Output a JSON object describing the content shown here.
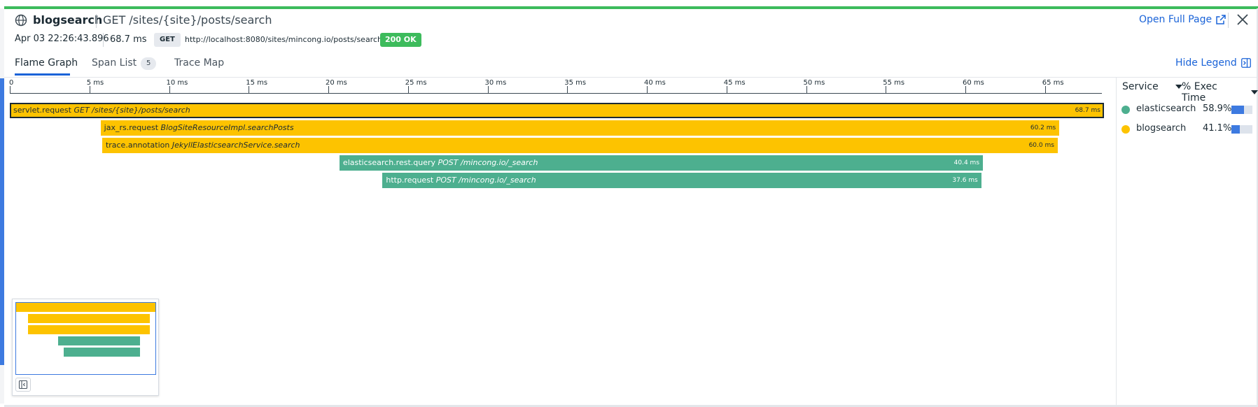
{
  "header": {
    "service": "blogsearch",
    "resource": "GET /sites/{site}/posts/search",
    "open_full_page": "Open Full Page",
    "date": "Apr 03 22:26:43.896",
    "duration": "68.7 ms",
    "method": "GET",
    "url": "http://localhost:8080/sites/mincong.io/posts/search",
    "status": "200 OK"
  },
  "tabs": [
    {
      "label": "Flame Graph",
      "active": true
    },
    {
      "label": "Span List",
      "badge": "5"
    },
    {
      "label": "Trace Map"
    }
  ],
  "hide_legend": "Hide Legend",
  "timeline": {
    "ticks": [
      "0",
      "5 ms",
      "10 ms",
      "15 ms",
      "20 ms",
      "25 ms",
      "30 ms",
      "35 ms",
      "40 ms",
      "45 ms",
      "50 ms",
      "55 ms",
      "60 ms",
      "65 ms"
    ],
    "total_ms": 68.7
  },
  "spans": [
    {
      "op": "servlet.request",
      "resource": "GET /sites/{site}/posts/search",
      "duration": "68.7 ms",
      "start_ms": 0,
      "dur_ms": 68.7,
      "service": "blogsearch",
      "selected": true
    },
    {
      "op": "jax_rs.request",
      "resource": "BlogSiteResourceImpl.searchPosts",
      "duration": "60.2 ms",
      "start_ms": 5.7,
      "dur_ms": 60.2,
      "service": "blogsearch"
    },
    {
      "op": "trace.annotation",
      "resource": "JekyllElasticsearchService.search",
      "duration": "60.0 ms",
      "start_ms": 5.8,
      "dur_ms": 60.0,
      "service": "blogsearch"
    },
    {
      "op": "elasticsearch.rest.query",
      "resource": "POST /mincong.io/_search",
      "duration": "40.4 ms",
      "start_ms": 20.7,
      "dur_ms": 40.4,
      "service": "elasticsearch"
    },
    {
      "op": "http.request",
      "resource": "POST /mincong.io/_search",
      "duration": "37.6 ms",
      "start_ms": 23.4,
      "dur_ms": 37.6,
      "service": "elasticsearch"
    }
  ],
  "legend": {
    "service_header": "Service",
    "exec_header": "% Exec Time",
    "items": [
      {
        "name": "elasticsearch",
        "pct": "58.9%",
        "fraction": 0.589,
        "color": "#4daf8f"
      },
      {
        "name": "blogsearch",
        "pct": "41.1%",
        "fraction": 0.411,
        "color": "#fdc300"
      }
    ]
  },
  "colors": {
    "blogsearch": "#fdc300",
    "elasticsearch": "#4daf8f",
    "accent": "#1a63d8",
    "status_ok": "#3dbb5c"
  },
  "icons": [
    "globe-icon",
    "external-link-icon",
    "close-icon",
    "hide-legend-icon",
    "collapse-minimap-icon",
    "sort-caret-icon"
  ]
}
